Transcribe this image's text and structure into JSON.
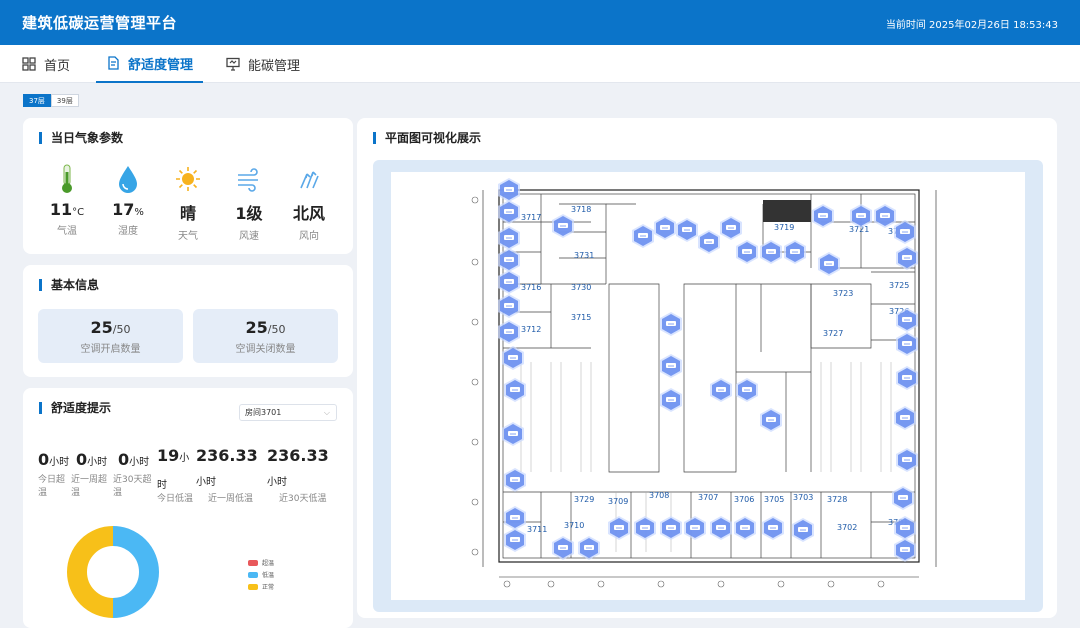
{
  "header": {
    "title": "建筑低碳运营管理平台",
    "clock": "当前时间 2025年02月26日 18:53:43"
  },
  "nav": {
    "tabs": [
      {
        "label": "首页",
        "icon": "grid-icon"
      },
      {
        "label": "舒适度管理",
        "icon": "document-icon"
      },
      {
        "label": "能碳管理",
        "icon": "monitor-icon"
      }
    ],
    "active": 1
  },
  "floors": [
    "37层",
    "39层"
  ],
  "weather": {
    "title": "当日气象参数",
    "items": [
      {
        "value": "11",
        "unit": "°C",
        "label": "气温",
        "icon": "thermometer-icon"
      },
      {
        "value": "17",
        "unit": "%",
        "label": "湿度",
        "icon": "water-drop-icon"
      },
      {
        "value": "晴",
        "unit": "",
        "label": "天气",
        "icon": "sun-icon"
      },
      {
        "value": "1级",
        "unit": "",
        "label": "风速",
        "icon": "wind-icon"
      },
      {
        "value": "北风",
        "unit": "",
        "label": "风向",
        "icon": "wind-direction-icon"
      }
    ]
  },
  "basic": {
    "title": "基本信息",
    "on": {
      "value": "25",
      "total": "/50",
      "label": "空调开启数量"
    },
    "off": {
      "value": "25",
      "total": "/50",
      "label": "空调关闭数量"
    }
  },
  "comfort": {
    "title": "舒适度提示",
    "room_select": "房间3701",
    "metrics": [
      {
        "value": "0",
        "unit": "小时",
        "label": "今日超温"
      },
      {
        "value": "0",
        "unit": "小时",
        "label": "近一周超温"
      },
      {
        "value": "0",
        "unit": "小时",
        "label": "近30天超温"
      },
      {
        "value": "19",
        "unit": "小时",
        "label": "今日低温"
      },
      {
        "value": "236.33",
        "unit": "小时",
        "label": "近一周低温"
      },
      {
        "value": "236.33",
        "unit": "小时",
        "label": "近30天低温"
      }
    ],
    "legend": [
      {
        "label": "超温",
        "color": "#e8585b"
      },
      {
        "label": "低温",
        "color": "#4bb8f4"
      },
      {
        "label": "正常",
        "color": "#f7c019"
      }
    ],
    "donut_shares": [
      0,
      0.5,
      0.5
    ]
  },
  "floorplan": {
    "title": "平面图可视化展示",
    "rooms": [
      "3717",
      "3718",
      "3731",
      "3719",
      "3721",
      "3722",
      "3716",
      "3730",
      "3715",
      "3723",
      "3725",
      "3726",
      "3712",
      "3727",
      "3729",
      "3709",
      "3708",
      "3707",
      "3706",
      "3705",
      "3703",
      "3728",
      "3711",
      "3710",
      "3702",
      "3701"
    ]
  }
}
